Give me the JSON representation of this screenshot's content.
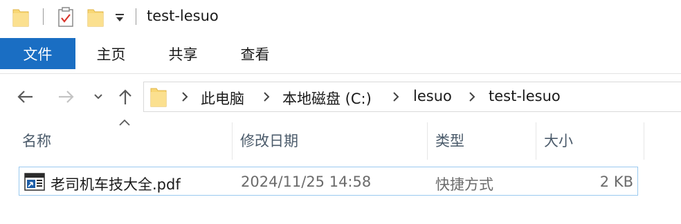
{
  "window": {
    "title": "test-lesuo"
  },
  "ribbon": {
    "tabs": [
      "文件",
      "主页",
      "共享",
      "查看"
    ]
  },
  "address": {
    "crumbs": [
      "此电脑",
      "本地磁盘 (C:)",
      "lesuo",
      "test-lesuo"
    ]
  },
  "columns": {
    "name": "名称",
    "date": "修改日期",
    "type": "类型",
    "size": "大小"
  },
  "files": [
    {
      "name": "老司机车技大全.pdf",
      "date": "2024/11/25 14:58",
      "type": "快捷方式",
      "size": "2 KB"
    }
  ],
  "colors": {
    "accent": "#1a6ec3",
    "folder": "#f8d775",
    "selection_border": "#99c9ef"
  }
}
